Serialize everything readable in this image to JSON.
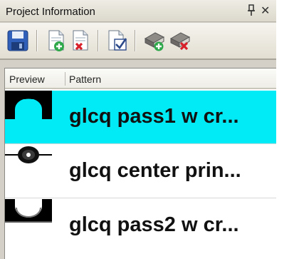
{
  "panel": {
    "title": "Project Information",
    "pin_glyph": "📌",
    "close_glyph": "✕"
  },
  "toolbar": {
    "buttons": [
      {
        "name": "save-icon"
      },
      {
        "name": "add-page-icon"
      },
      {
        "name": "remove-page-icon"
      },
      {
        "name": "checked-page-icon"
      },
      {
        "name": "add-book-icon"
      },
      {
        "name": "remove-book-icon"
      }
    ]
  },
  "list": {
    "columns": [
      "Preview",
      "Pattern"
    ],
    "rows": [
      {
        "pattern": "glcq pass1 w cr...",
        "selected": true
      },
      {
        "pattern": "glcq center prin...",
        "selected": false
      },
      {
        "pattern": "glcq pass2 w cr...",
        "selected": false
      }
    ]
  },
  "colors": {
    "selected_row": "#00ebf5",
    "panel_bg": "#d4d0c8"
  }
}
